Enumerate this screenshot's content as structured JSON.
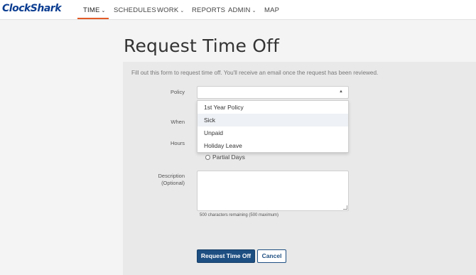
{
  "brand": {
    "logo_text": "ClockShark"
  },
  "nav": {
    "time": "TIME",
    "schedules": "SCHEDULES",
    "work": "WORK",
    "reports": "REPORTS",
    "admin": "ADMIN",
    "map": "MAP"
  },
  "page": {
    "title": "Request Time Off",
    "intro": "Fill out this form to request time off. You'll receive an email once the request has been reviewed."
  },
  "form": {
    "policy_label": "Policy",
    "when_label": "When",
    "hours_label": "Hours",
    "description_label_1": "Description",
    "description_label_2": "(Optional)",
    "partial_days_label": "Partial Days",
    "char_count": "500 characters remaining (500 maximum)"
  },
  "dropdown": {
    "options": [
      "1st Year Policy",
      "Sick",
      "Unpaid",
      "Holiday Leave"
    ]
  },
  "buttons": {
    "submit": "Request Time Off",
    "cancel": "Cancel"
  },
  "colors": {
    "brand": "#0b3d91",
    "accent": "#e15b26",
    "primary_button": "#1e4f82"
  }
}
